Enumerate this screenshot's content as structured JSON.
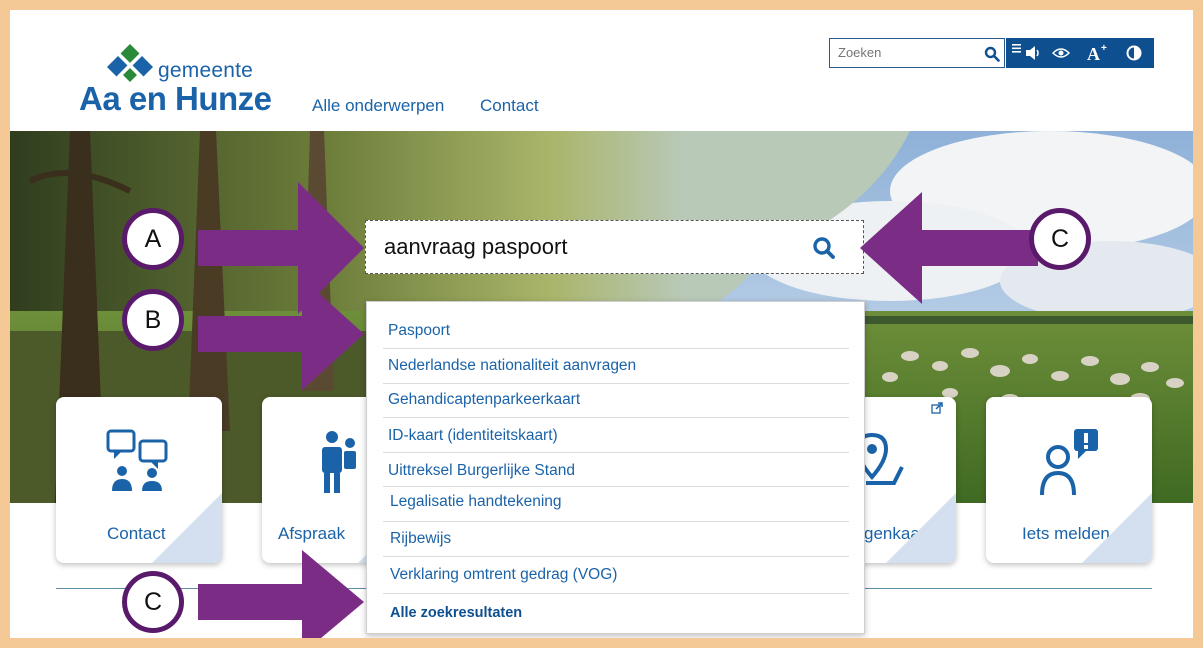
{
  "header": {
    "logo_top": "gemeente",
    "logo_main": "Aa en Hunze",
    "nav": [
      "Alle onderwerpen",
      "Contact"
    ],
    "search_placeholder": "Zoeken",
    "toolbar_icons": [
      "menu-icon",
      "speaker-icon",
      "eye-icon",
      "font-size-icon",
      "contrast-icon"
    ]
  },
  "search": {
    "value": "aanvraag paspoort"
  },
  "dropdown": {
    "items": [
      "Paspoort",
      "Nederlandse nationaliteit aanvragen",
      "Gehandicaptenparkeerkaart",
      "ID-kaart (identiteitskaart)",
      "Uittreksel Burgerlijke Stand",
      "Legalisatie handtekening",
      "Rijbewijs",
      "Verklaring omtrent gedrag (VOG)"
    ],
    "all_results": "Alle zoekresultaten"
  },
  "tiles": [
    {
      "label": "Contact",
      "icon": "chat-people-icon"
    },
    {
      "label": "Afspraak",
      "icon": "family-icon"
    },
    {
      "label": "genkaart",
      "icon": "map-pin-icon"
    },
    {
      "label": "Iets melden",
      "icon": "person-alert-icon"
    }
  ],
  "annotations": [
    "A",
    "B",
    "C",
    "C"
  ],
  "colors": {
    "brand_blue": "#1b63a8",
    "toolbar_blue": "#0e4f90",
    "annotation_purple": "#5a1a6b",
    "frame_border": "#f4c995"
  }
}
